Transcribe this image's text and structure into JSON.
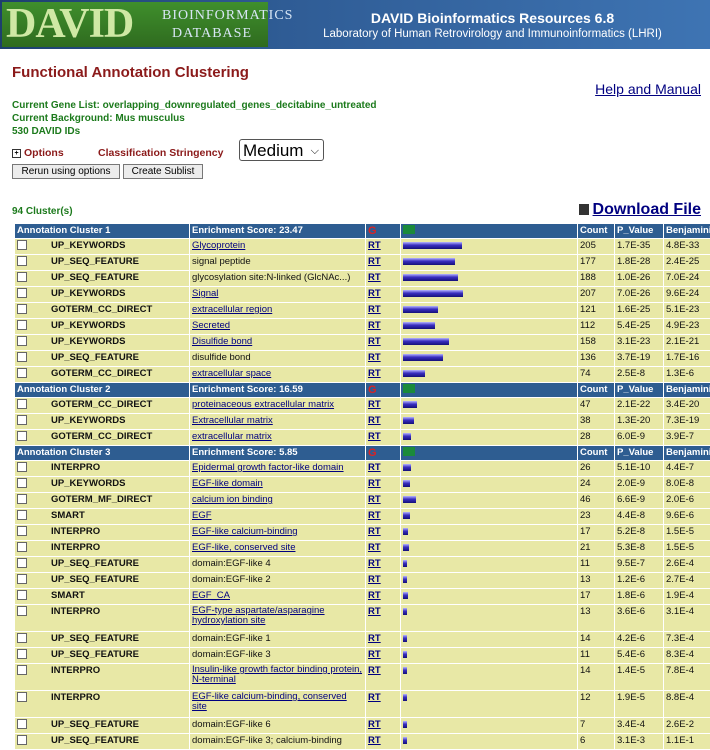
{
  "banner": {
    "logo_main": "DAVID",
    "logo_sub1": "BIOINFORMATICS",
    "logo_sub2": "DATABASE",
    "title": "DAVID Bioinformatics Resources 6.8",
    "subtitle": "Laboratory of Human Retrovirology and Immunoinformatics (LHRI)"
  },
  "page_title": "Functional Annotation Clustering",
  "help_link": "Help and Manual",
  "info": {
    "gene_list": "Current Gene List: overlapping_downregulated_genes_decitabine_untreated",
    "background": "Current Background: Mus musculus",
    "ids": "530 DAVID IDs"
  },
  "options": {
    "expand_icon": "plus-box-icon",
    "label": "Options",
    "stringency_label": "Classification Stringency",
    "stringency_value": "Medium"
  },
  "buttons": {
    "rerun": "Rerun using options",
    "sublist": "Create Sublist"
  },
  "cluster_count": "94 Cluster(s)",
  "download": "Download File",
  "colors": {
    "header": "#2e5d91",
    "row": "#e8e8a6",
    "title": "#8b1a1a",
    "info": "#1c7a1c",
    "link": "#000080"
  },
  "columns": {
    "count": "Count",
    "pvalue": "P_Value",
    "benjamini": "Benjamini"
  },
  "rt_label": "RT",
  "g_label": "G",
  "clusters": [
    {
      "name": "Annotation Cluster 1",
      "score": "Enrichment Score: 23.47",
      "rows": [
        {
          "category": "UP_KEYWORDS",
          "term": "Glycoprotein",
          "link": true,
          "count": "205",
          "pvalue": "1.7E-35",
          "benjamini": "4.8E-33",
          "fraction": 0.99
        },
        {
          "category": "UP_SEQ_FEATURE",
          "term": "signal peptide",
          "link": false,
          "count": "177",
          "pvalue": "1.8E-28",
          "benjamini": "2.4E-25",
          "fraction": 0.86
        },
        {
          "category": "UP_SEQ_FEATURE",
          "term": "glycosylation site:N-linked (GlcNAc...)",
          "link": false,
          "count": "188",
          "pvalue": "1.0E-26",
          "benjamini": "7.0E-24",
          "fraction": 0.91
        },
        {
          "category": "UP_KEYWORDS",
          "term": "Signal",
          "link": true,
          "count": "207",
          "pvalue": "7.0E-26",
          "benjamini": "9.6E-24",
          "fraction": 1.0
        },
        {
          "category": "GOTERM_CC_DIRECT",
          "term": "extracellular region",
          "link": true,
          "count": "121",
          "pvalue": "1.6E-25",
          "benjamini": "5.1E-23",
          "fraction": 0.59
        },
        {
          "category": "UP_KEYWORDS",
          "term": "Secreted",
          "link": true,
          "count": "112",
          "pvalue": "5.4E-25",
          "benjamini": "4.9E-23",
          "fraction": 0.54
        },
        {
          "category": "UP_KEYWORDS",
          "term": "Disulfide bond",
          "link": true,
          "count": "158",
          "pvalue": "3.1E-23",
          "benjamini": "2.1E-21",
          "fraction": 0.76
        },
        {
          "category": "UP_SEQ_FEATURE",
          "term": "disulfide bond",
          "link": false,
          "count": "136",
          "pvalue": "3.7E-19",
          "benjamini": "1.7E-16",
          "fraction": 0.66
        },
        {
          "category": "GOTERM_CC_DIRECT",
          "term": "extracellular space",
          "link": true,
          "count": "74",
          "pvalue": "2.5E-8",
          "benjamini": "1.3E-6",
          "fraction": 0.36
        }
      ]
    },
    {
      "name": "Annotation Cluster 2",
      "score": "Enrichment Score: 16.59",
      "rows": [
        {
          "category": "GOTERM_CC_DIRECT",
          "term": "proteinaceous extracellular matrix",
          "link": true,
          "count": "47",
          "pvalue": "2.1E-22",
          "benjamini": "3.4E-20",
          "fraction": 0.23
        },
        {
          "category": "UP_KEYWORDS",
          "term": "Extracellular matrix",
          "link": true,
          "count": "38",
          "pvalue": "1.3E-20",
          "benjamini": "7.3E-19",
          "fraction": 0.18
        },
        {
          "category": "GOTERM_CC_DIRECT",
          "term": "extracellular matrix",
          "link": true,
          "count": "28",
          "pvalue": "6.0E-9",
          "benjamini": "3.9E-7",
          "fraction": 0.14
        }
      ]
    },
    {
      "name": "Annotation Cluster 3",
      "score": "Enrichment Score: 5.85",
      "rows": [
        {
          "category": "INTERPRO",
          "term": "Epidermal growth factor-like domain",
          "link": true,
          "count": "26",
          "pvalue": "5.1E-10",
          "benjamini": "4.4E-7",
          "fraction": 0.13
        },
        {
          "category": "UP_KEYWORDS",
          "term": "EGF-like domain",
          "link": true,
          "count": "24",
          "pvalue": "2.0E-9",
          "benjamini": "8.0E-8",
          "fraction": 0.12
        },
        {
          "category": "GOTERM_MF_DIRECT",
          "term": "calcium ion binding",
          "link": true,
          "count": "46",
          "pvalue": "6.6E-9",
          "benjamini": "2.0E-6",
          "fraction": 0.22
        },
        {
          "category": "SMART",
          "term": "EGF",
          "link": true,
          "count": "23",
          "pvalue": "4.4E-8",
          "benjamini": "9.6E-6",
          "fraction": 0.11
        },
        {
          "category": "INTERPRO",
          "term": "EGF-like calcium-binding",
          "link": true,
          "count": "17",
          "pvalue": "5.2E-8",
          "benjamini": "1.5E-5",
          "fraction": 0.08
        },
        {
          "category": "INTERPRO",
          "term": "EGF-like, conserved site",
          "link": true,
          "count": "21",
          "pvalue": "5.3E-8",
          "benjamini": "1.5E-5",
          "fraction": 0.1
        },
        {
          "category": "UP_SEQ_FEATURE",
          "term": "domain:EGF-like 4",
          "link": false,
          "count": "11",
          "pvalue": "9.5E-7",
          "benjamini": "2.6E-4",
          "fraction": 0.05
        },
        {
          "category": "UP_SEQ_FEATURE",
          "term": "domain:EGF-like 2",
          "link": false,
          "count": "13",
          "pvalue": "1.2E-6",
          "benjamini": "2.7E-4",
          "fraction": 0.06
        },
        {
          "category": "SMART",
          "term": "EGF_CA",
          "link": true,
          "count": "17",
          "pvalue": "1.8E-6",
          "benjamini": "1.9E-4",
          "fraction": 0.08
        },
        {
          "category": "INTERPRO",
          "term": "EGF-type aspartate/asparagine hydroxylation site",
          "link": true,
          "count": "13",
          "pvalue": "3.6E-6",
          "benjamini": "3.1E-4",
          "fraction": 0.06,
          "tall": true
        },
        {
          "category": "UP_SEQ_FEATURE",
          "term": "domain:EGF-like 1",
          "link": false,
          "count": "14",
          "pvalue": "4.2E-6",
          "benjamini": "7.3E-4",
          "fraction": 0.07
        },
        {
          "category": "UP_SEQ_FEATURE",
          "term": "domain:EGF-like 3",
          "link": false,
          "count": "11",
          "pvalue": "5.4E-6",
          "benjamini": "8.3E-4",
          "fraction": 0.05
        },
        {
          "category": "INTERPRO",
          "term": "Insulin-like growth factor binding protein, N-terminal",
          "link": true,
          "count": "14",
          "pvalue": "1.4E-5",
          "benjamini": "7.8E-4",
          "fraction": 0.07,
          "tall": true
        },
        {
          "category": "INTERPRO",
          "term": "EGF-like calcium-binding, conserved site",
          "link": true,
          "count": "12",
          "pvalue": "1.9E-5",
          "benjamini": "8.8E-4",
          "fraction": 0.06,
          "tall": true
        },
        {
          "category": "UP_SEQ_FEATURE",
          "term": "domain:EGF-like 6",
          "link": false,
          "count": "7",
          "pvalue": "3.4E-4",
          "benjamini": "2.6E-2",
          "fraction": 0.03
        },
        {
          "category": "UP_SEQ_FEATURE",
          "term": "domain:EGF-like 3; calcium-binding",
          "link": false,
          "count": "6",
          "pvalue": "3.1E-3",
          "benjamini": "1.1E-1",
          "fraction": 0.03
        }
      ]
    }
  ]
}
